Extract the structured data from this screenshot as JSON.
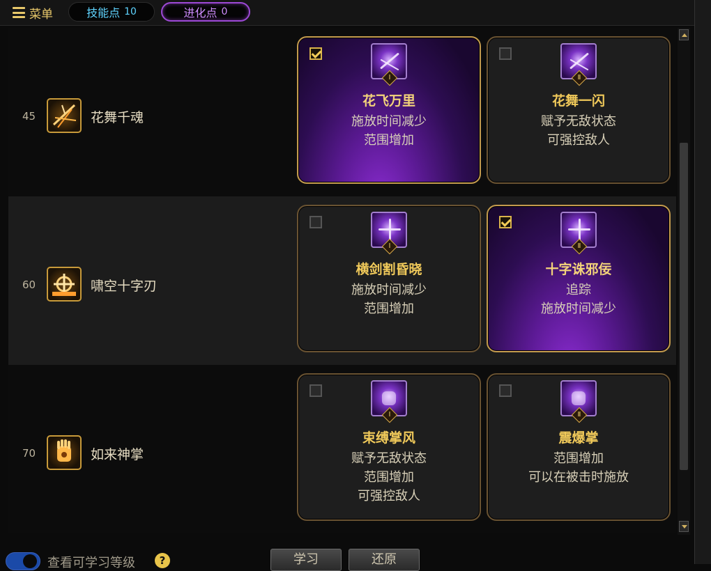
{
  "topbar": {
    "menu_label": "菜单",
    "skill_points_label": "技能点",
    "skill_points_value": "10",
    "evolution_points_label": "进化点",
    "evolution_points_value": "0"
  },
  "rows": [
    {
      "level": "45",
      "skill_name": "花舞千魂",
      "cards": [
        {
          "rank": "Ⅰ",
          "checked": true,
          "title": "花飞万里",
          "lines": [
            "施放时间减少",
            "范围增加"
          ]
        },
        {
          "rank": "Ⅱ",
          "checked": false,
          "title": "花舞一闪",
          "lines": [
            "赋予无敌状态",
            "可强控敌人"
          ]
        }
      ]
    },
    {
      "level": "60",
      "skill_name": "啸空十字刃",
      "cards": [
        {
          "rank": "Ⅰ",
          "checked": false,
          "title": "横剑割昏晓",
          "lines": [
            "施放时间减少",
            "范围增加"
          ]
        },
        {
          "rank": "Ⅱ",
          "checked": true,
          "title": "十字诛邪佞",
          "lines": [
            "追踪",
            "施放时间减少"
          ]
        }
      ]
    },
    {
      "level": "70",
      "skill_name": "如来神掌",
      "cards": [
        {
          "rank": "Ⅰ",
          "checked": false,
          "title": "束缚掌风",
          "lines": [
            "赋予无敌状态",
            "范围增加",
            "可强控敌人"
          ]
        },
        {
          "rank": "Ⅱ",
          "checked": false,
          "title": "震爆掌",
          "lines": [
            "范围增加",
            "可以在被击时施放"
          ]
        }
      ]
    }
  ],
  "bottom": {
    "view_learnable_label": "查看可学习等级",
    "help_icon": "?",
    "learn_button": "学习",
    "reset_button": "还原"
  },
  "colors": {
    "accent_gold": "#f0c95a",
    "evolution_purple": "#9d49d6",
    "skill_points_blue": "#5fd4ff"
  }
}
